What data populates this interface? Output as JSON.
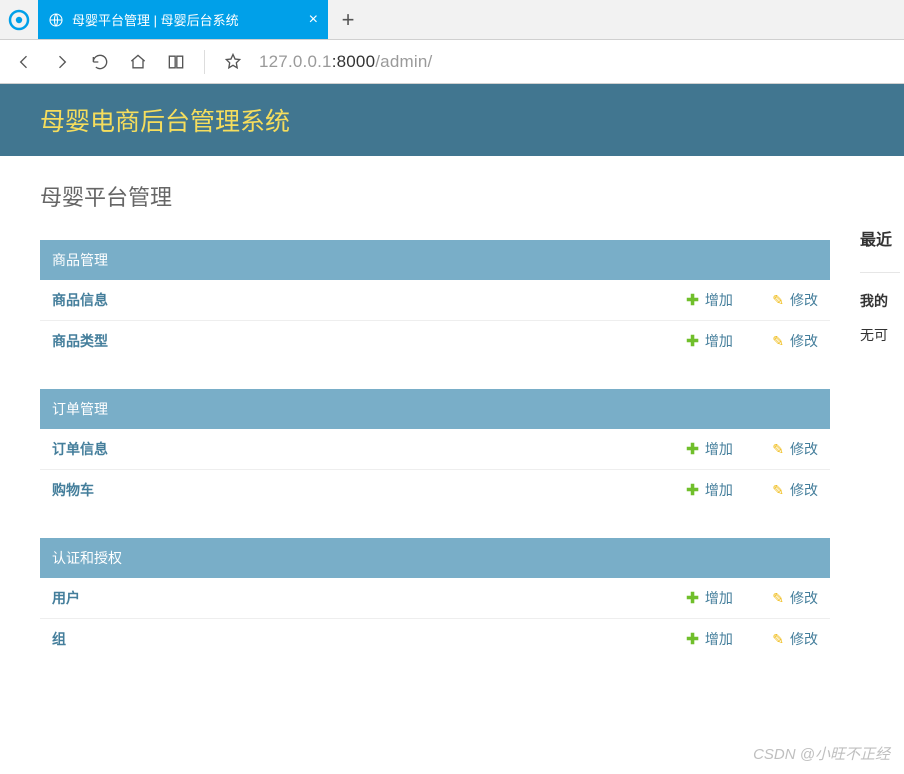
{
  "browser": {
    "tab_title": "母婴平台管理 | 母婴后台系统",
    "url_gray1": "127.0.0.1",
    "url_port": ":8000",
    "url_path": "/admin/"
  },
  "header": {
    "title": "母婴电商后台管理系统"
  },
  "page": {
    "title": "母婴平台管理"
  },
  "labels": {
    "add": "增加",
    "change": "修改"
  },
  "modules": [
    {
      "caption": "商品管理",
      "models": [
        "商品信息",
        "商品类型"
      ]
    },
    {
      "caption": "订单管理",
      "models": [
        "订单信息",
        "购物车"
      ]
    },
    {
      "caption": "认证和授权",
      "models": [
        "用户",
        "组"
      ]
    }
  ],
  "sidebar": {
    "recent": "最近",
    "my_actions": "我的",
    "none": "无可"
  },
  "watermark": "CSDN @小旺不正经"
}
